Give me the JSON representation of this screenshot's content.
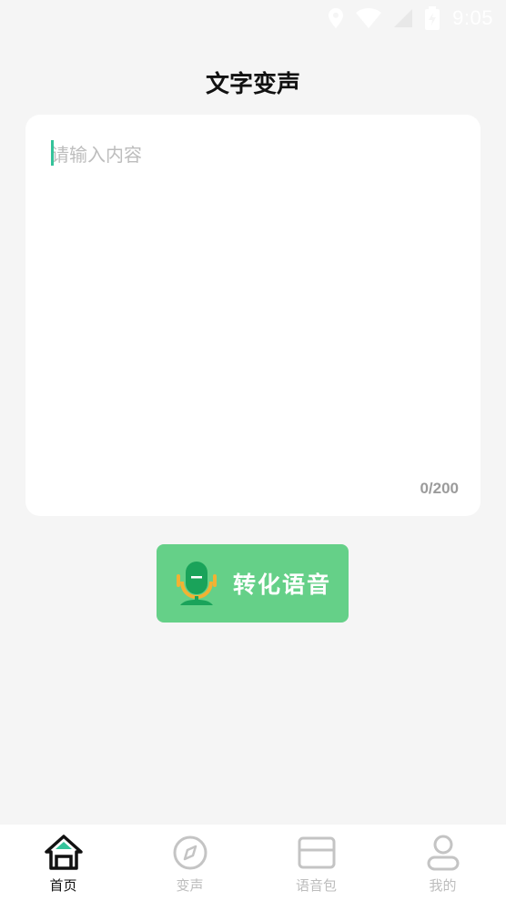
{
  "status_bar": {
    "time": "9:05"
  },
  "header": {
    "title": "文字变声"
  },
  "editor": {
    "placeholder": "请输入内容",
    "value": "",
    "char_count": "0/200"
  },
  "convert": {
    "label": "转化语音"
  },
  "tabs": [
    {
      "label": "首页",
      "icon": "home-icon",
      "active": true
    },
    {
      "label": "变声",
      "icon": "compass-icon",
      "active": false
    },
    {
      "label": "语音包",
      "icon": "folder-icon",
      "active": false
    },
    {
      "label": "我的",
      "icon": "user-icon",
      "active": false
    }
  ],
  "colors": {
    "accent": "#65d088",
    "accent_dark": "#1aa35a",
    "cursor": "#34c39a",
    "inactive": "#bdbdbd"
  }
}
